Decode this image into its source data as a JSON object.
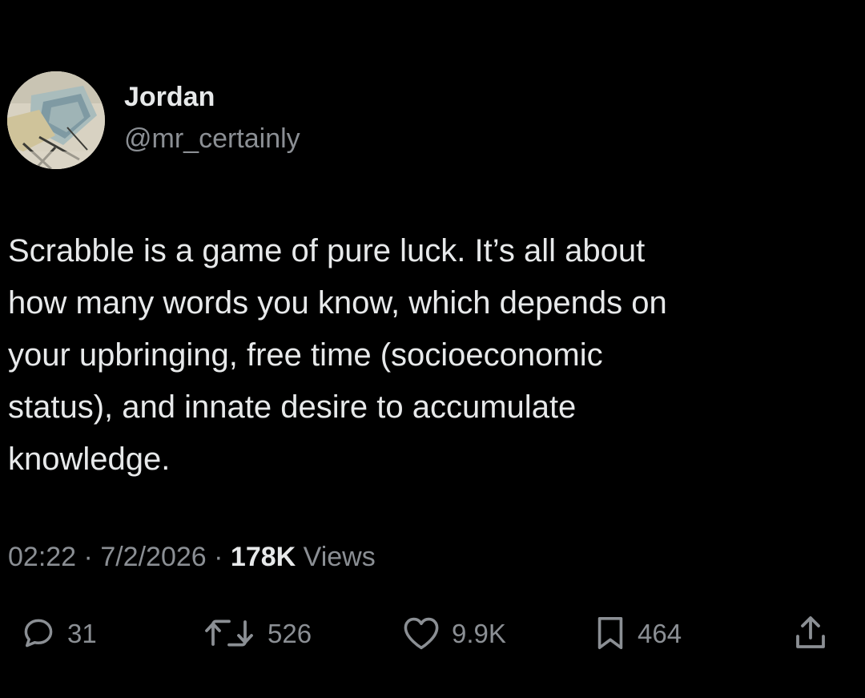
{
  "author": {
    "display_name": "Jordan",
    "handle": "@mr_certainly",
    "avatar_icon": "avatar-photo"
  },
  "tweet": {
    "text": "Scrabble is a game of pure luck. It’s all about\nhow many words you know, which depends on\nyour upbringing, free time (socioeconomic\nstatus), and innate desire to accumulate\nknowledge."
  },
  "meta": {
    "time": "02:22",
    "separator": "·",
    "date": "7/2/2026",
    "views_count": "178K",
    "views_label": "Views"
  },
  "actions": {
    "replies": {
      "icon": "reply-icon",
      "count": "31"
    },
    "reposts": {
      "icon": "repost-icon",
      "count": "526"
    },
    "likes": {
      "icon": "heart-icon",
      "count": "9.9K"
    },
    "bookmarks": {
      "icon": "bookmark-icon",
      "count": "464"
    },
    "share": {
      "icon": "share-icon"
    }
  },
  "colors": {
    "background": "#000000",
    "primary_text": "#e7e9ea",
    "secondary_text": "#8b8f94"
  }
}
